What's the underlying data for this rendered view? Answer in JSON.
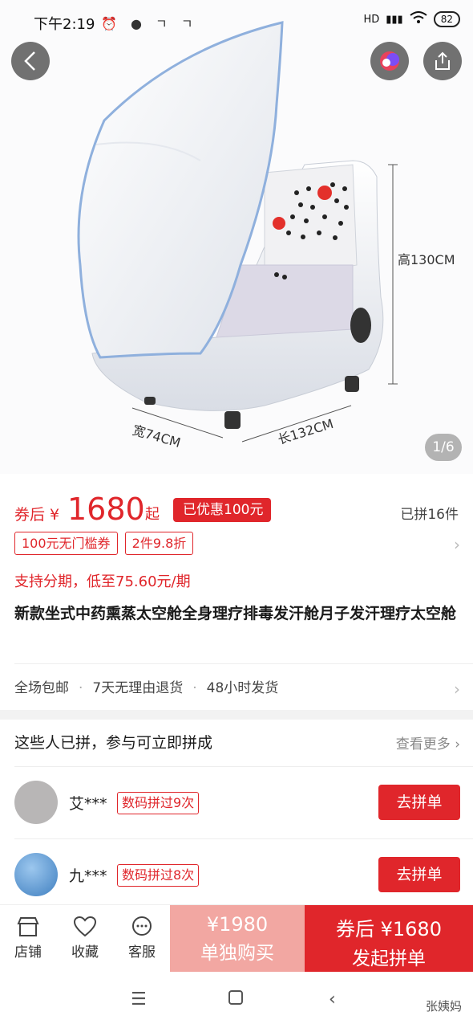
{
  "status_bar": {
    "time": "下午2:19",
    "network": "HD",
    "battery": "82"
  },
  "hero": {
    "pager": "1/6",
    "dimensions": {
      "height": "高130CM",
      "width": "宽74CM",
      "length": "长132CM"
    }
  },
  "price": {
    "prefix": "券后 ¥",
    "value": "1680",
    "suffix": "起",
    "discount_tag": "已优惠100元",
    "joined": "已拼16件"
  },
  "coupons": [
    "100元无门槛券",
    "2件9.8折"
  ],
  "installment": "支持分期，低至75.60元/期",
  "product_title": "新款坐式中药熏蒸太空舱全身理疗排毒发汗舱月子发汗理疗太空舱",
  "services": [
    "全场包邮",
    "7天无理由退货",
    "48小时发货"
  ],
  "group_buy": {
    "title": "这些人已拼，参与可立即拼成",
    "see_more": "查看更多",
    "buyers": [
      {
        "name": "艾***",
        "tag": "数码拼过9次",
        "button": "去拼单"
      },
      {
        "name": "九***",
        "tag": "数码拼过8次",
        "button": "去拼单"
      }
    ]
  },
  "bottom_bar": {
    "tabs": [
      {
        "label": "店铺",
        "icon": "store-icon"
      },
      {
        "label": "收藏",
        "icon": "heart-icon"
      },
      {
        "label": "客服",
        "icon": "chat-icon"
      }
    ],
    "solo": {
      "price": "¥1980",
      "label": "单独购买"
    },
    "group": {
      "price": "券后 ¥1680",
      "label": "发起拼单"
    }
  },
  "watermark": "张姨妈",
  "colors": {
    "accent": "#e0262b",
    "solo_button": "#f2a7a2"
  }
}
